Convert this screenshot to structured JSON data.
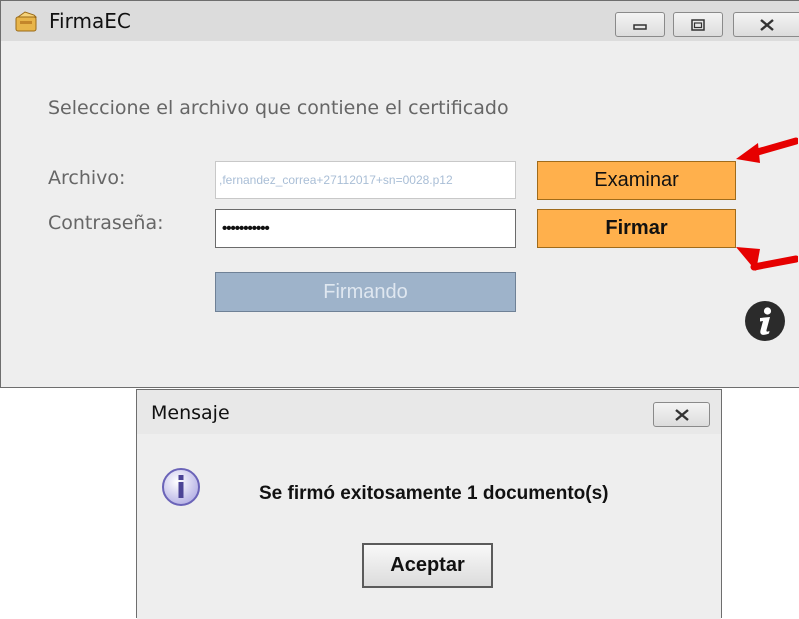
{
  "window": {
    "title": "FirmaEC",
    "prompt": "Seleccione el archivo que contiene el certificado",
    "file_label": "Archivo:",
    "file_value": ",fernandez_correa+27112017+sn=0028.p12",
    "password_label": "Contraseña:",
    "password_value": "•••••••••••",
    "browse_label": "Examinar",
    "sign_label": "Firmar",
    "busy_label": "Firmando"
  },
  "dialog": {
    "title": "Mensaje",
    "message_pre": "Se firmó exitosamente ",
    "message_count": "1",
    "message_post": " documento(s)",
    "ok_label": "Aceptar"
  },
  "colors": {
    "accent_button": "#ffb04c",
    "annotation_arrow": "#e60000",
    "busy_button": "#9eb3ca"
  },
  "icons": [
    "app-icon",
    "minimize-icon",
    "maximize-icon",
    "close-icon",
    "info-icon",
    "red-arrow"
  ]
}
